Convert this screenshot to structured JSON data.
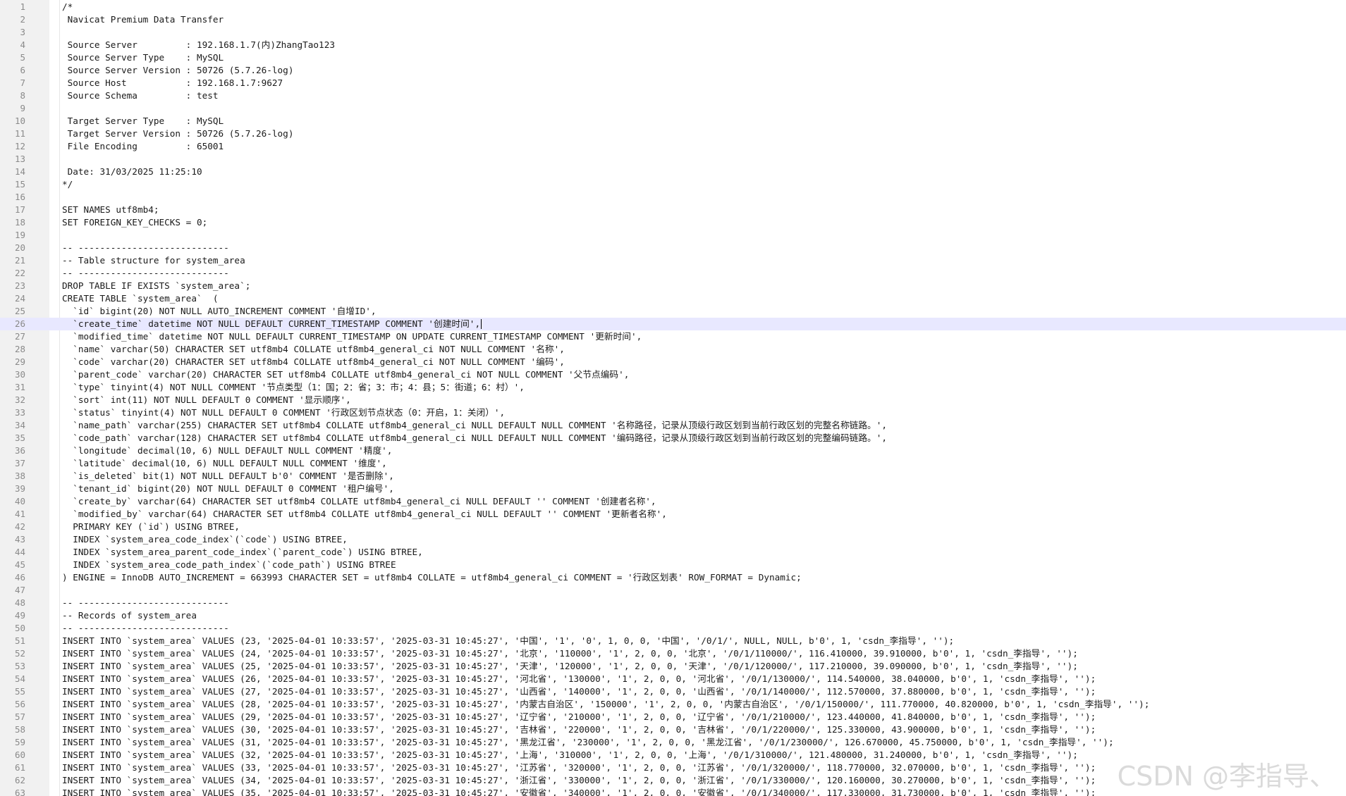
{
  "editor": {
    "current_line": 26,
    "lines": [
      "/*",
      " Navicat Premium Data Transfer",
      "",
      " Source Server         : 192.168.1.7(内)ZhangTao123",
      " Source Server Type    : MySQL",
      " Source Server Version : 50726 (5.7.26-log)",
      " Source Host           : 192.168.1.7:9627",
      " Source Schema         : test",
      "",
      " Target Server Type    : MySQL",
      " Target Server Version : 50726 (5.7.26-log)",
      " File Encoding         : 65001",
      "",
      " Date: 31/03/2025 11:25:10",
      "*/",
      "",
      "SET NAMES utf8mb4;",
      "SET FOREIGN_KEY_CHECKS = 0;",
      "",
      "-- ----------------------------",
      "-- Table structure for system_area",
      "-- ----------------------------",
      "DROP TABLE IF EXISTS `system_area`;",
      "CREATE TABLE `system_area`  (",
      "  `id` bigint(20) NOT NULL AUTO_INCREMENT COMMENT '自增ID',",
      "  `create_time` datetime NOT NULL DEFAULT CURRENT_TIMESTAMP COMMENT '创建时间',",
      "  `modified_time` datetime NOT NULL DEFAULT CURRENT_TIMESTAMP ON UPDATE CURRENT_TIMESTAMP COMMENT '更新时间',",
      "  `name` varchar(50) CHARACTER SET utf8mb4 COLLATE utf8mb4_general_ci NOT NULL COMMENT '名称',",
      "  `code` varchar(20) CHARACTER SET utf8mb4 COLLATE utf8mb4_general_ci NOT NULL COMMENT '编码',",
      "  `parent_code` varchar(20) CHARACTER SET utf8mb4 COLLATE utf8mb4_general_ci NOT NULL COMMENT '父节点编码',",
      "  `type` tinyint(4) NOT NULL COMMENT '节点类型（1：国；2：省；3：市；4：县；5：街道；6：村）',",
      "  `sort` int(11) NOT NULL DEFAULT 0 COMMENT '显示顺序',",
      "  `status` tinyint(4) NOT NULL DEFAULT 0 COMMENT '行政区划节点状态（0：开启，1：关闭）',",
      "  `name_path` varchar(255) CHARACTER SET utf8mb4 COLLATE utf8mb4_general_ci NULL DEFAULT NULL COMMENT '名称路径，记录从顶级行政区划到当前行政区划的完整名称链路。',",
      "  `code_path` varchar(128) CHARACTER SET utf8mb4 COLLATE utf8mb4_general_ci NULL DEFAULT NULL COMMENT '编码路径，记录从顶级行政区划到当前行政区划的完整编码链路。',",
      "  `longitude` decimal(10, 6) NULL DEFAULT NULL COMMENT '精度',",
      "  `latitude` decimal(10, 6) NULL DEFAULT NULL COMMENT '维度',",
      "  `is_deleted` bit(1) NOT NULL DEFAULT b'0' COMMENT '是否删除',",
      "  `tenant_id` bigint(20) NOT NULL DEFAULT 0 COMMENT '租户编号',",
      "  `create_by` varchar(64) CHARACTER SET utf8mb4 COLLATE utf8mb4_general_ci NULL DEFAULT '' COMMENT '创建者名称',",
      "  `modified_by` varchar(64) CHARACTER SET utf8mb4 COLLATE utf8mb4_general_ci NULL DEFAULT '' COMMENT '更新者名称',",
      "  PRIMARY KEY (`id`) USING BTREE,",
      "  INDEX `system_area_code_index`(`code`) USING BTREE,",
      "  INDEX `system_area_parent_code_index`(`parent_code`) USING BTREE,",
      "  INDEX `system_area_code_path_index`(`code_path`) USING BTREE",
      ") ENGINE = InnoDB AUTO_INCREMENT = 663993 CHARACTER SET = utf8mb4 COLLATE = utf8mb4_general_ci COMMENT = '行政区划表' ROW_FORMAT = Dynamic;",
      "",
      "-- ----------------------------",
      "-- Records of system_area",
      "-- ----------------------------",
      "INSERT INTO `system_area` VALUES (23, '2025-04-01 10:33:57', '2025-03-31 10:45:27', '中国', '1', '0', 1, 0, 0, '中国', '/0/1/', NULL, NULL, b'0', 1, 'csdn_李指导', '');",
      "INSERT INTO `system_area` VALUES (24, '2025-04-01 10:33:57', '2025-03-31 10:45:27', '北京', '110000', '1', 2, 0, 0, '北京', '/0/1/110000/', 116.410000, 39.910000, b'0', 1, 'csdn_李指导', '');",
      "INSERT INTO `system_area` VALUES (25, '2025-04-01 10:33:57', '2025-03-31 10:45:27', '天津', '120000', '1', 2, 0, 0, '天津', '/0/1/120000/', 117.210000, 39.090000, b'0', 1, 'csdn_李指导', '');",
      "INSERT INTO `system_area` VALUES (26, '2025-04-01 10:33:57', '2025-03-31 10:45:27', '河北省', '130000', '1', 2, 0, 0, '河北省', '/0/1/130000/', 114.540000, 38.040000, b'0', 1, 'csdn_李指导', '');",
      "INSERT INTO `system_area` VALUES (27, '2025-04-01 10:33:57', '2025-03-31 10:45:27', '山西省', '140000', '1', 2, 0, 0, '山西省', '/0/1/140000/', 112.570000, 37.880000, b'0', 1, 'csdn_李指导', '');",
      "INSERT INTO `system_area` VALUES (28, '2025-04-01 10:33:57', '2025-03-31 10:45:27', '内蒙古自治区', '150000', '1', 2, 0, 0, '内蒙古自治区', '/0/1/150000/', 111.770000, 40.820000, b'0', 1, 'csdn_李指导', '');",
      "INSERT INTO `system_area` VALUES (29, '2025-04-01 10:33:57', '2025-03-31 10:45:27', '辽宁省', '210000', '1', 2, 0, 0, '辽宁省', '/0/1/210000/', 123.440000, 41.840000, b'0', 1, 'csdn_李指导', '');",
      "INSERT INTO `system_area` VALUES (30, '2025-04-01 10:33:57', '2025-03-31 10:45:27', '吉林省', '220000', '1', 2, 0, 0, '吉林省', '/0/1/220000/', 125.330000, 43.900000, b'0', 1, 'csdn_李指导', '');",
      "INSERT INTO `system_area` VALUES (31, '2025-04-01 10:33:57', '2025-03-31 10:45:27', '黑龙江省', '230000', '1', 2, 0, 0, '黑龙江省', '/0/1/230000/', 126.670000, 45.750000, b'0', 1, 'csdn_李指导', '');",
      "INSERT INTO `system_area` VALUES (32, '2025-04-01 10:33:57', '2025-03-31 10:45:27', '上海', '310000', '1', 2, 0, 0, '上海', '/0/1/310000/', 121.480000, 31.240000, b'0', 1, 'csdn_李指导', '');",
      "INSERT INTO `system_area` VALUES (33, '2025-04-01 10:33:57', '2025-03-31 10:45:27', '江苏省', '320000', '1', 2, 0, 0, '江苏省', '/0/1/320000/', 118.770000, 32.070000, b'0', 1, 'csdn_李指导', '');",
      "INSERT INTO `system_area` VALUES (34, '2025-04-01 10:33:57', '2025-03-31 10:45:27', '浙江省', '330000', '1', 2, 0, 0, '浙江省', '/0/1/330000/', 120.160000, 30.270000, b'0', 1, 'csdn_李指导', '');",
      "INSERT INTO `system_area` VALUES (35, '2025-04-01 10:33:57', '2025-03-31 10:45:27', '安徽省', '340000', '1', 2, 0, 0, '安徽省', '/0/1/340000/', 117.330000, 31.730000, b'0', 1, 'csdn_李指导', '');"
    ]
  },
  "watermark": "CSDN @李指导、"
}
